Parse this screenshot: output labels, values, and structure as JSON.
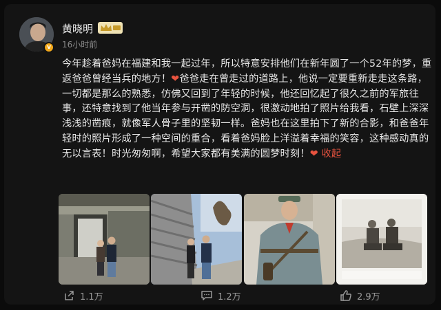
{
  "post": {
    "author": "黄晓明",
    "time": "16小时前",
    "text_before_heart_1": "今年趁着爸妈在福建和我一起过年，所以特意安排他们在新年圆了一个52年的梦，重返爸爸曾经当兵的地方！",
    "text_between_hearts": "爸爸走在曾走过的道路上，他说一定要重新走走这条路，一切都是那么的熟悉，仿佛又回到了年轻的时候，他还回忆起了很久之前的军旅往事，还特意找到了他当年参与开凿的防空洞，很激动地拍了照片给我看，石壁上深深浅浅的凿痕，就像军人骨子里的坚韧一样。爸妈也在这里拍下了新的合影，和爸爸年轻时的照片形成了一种空间的重合，看着爸妈脸上洋溢着幸福的笑容，这种感动真的无以言表！时光匆匆啊，希望大家都有美满的圆梦时刻！",
    "heart_glyph": "❤",
    "collapse_label": "收起"
  },
  "photos": [
    {
      "icon": "photo-tunnel-entrance-couple"
    },
    {
      "icon": "photo-stone-wall-couple"
    },
    {
      "icon": "photo-soldier-portrait"
    },
    {
      "icon": "photo-old-bw-soldiers"
    }
  ],
  "actions": {
    "share_count": "1.1万",
    "comment_count": "1.2万",
    "like_count": "2.9万"
  },
  "colors": {
    "background": "#141414",
    "text": "#e6e6e6",
    "accent": "#e8533f",
    "muted": "#8a8a8a"
  }
}
